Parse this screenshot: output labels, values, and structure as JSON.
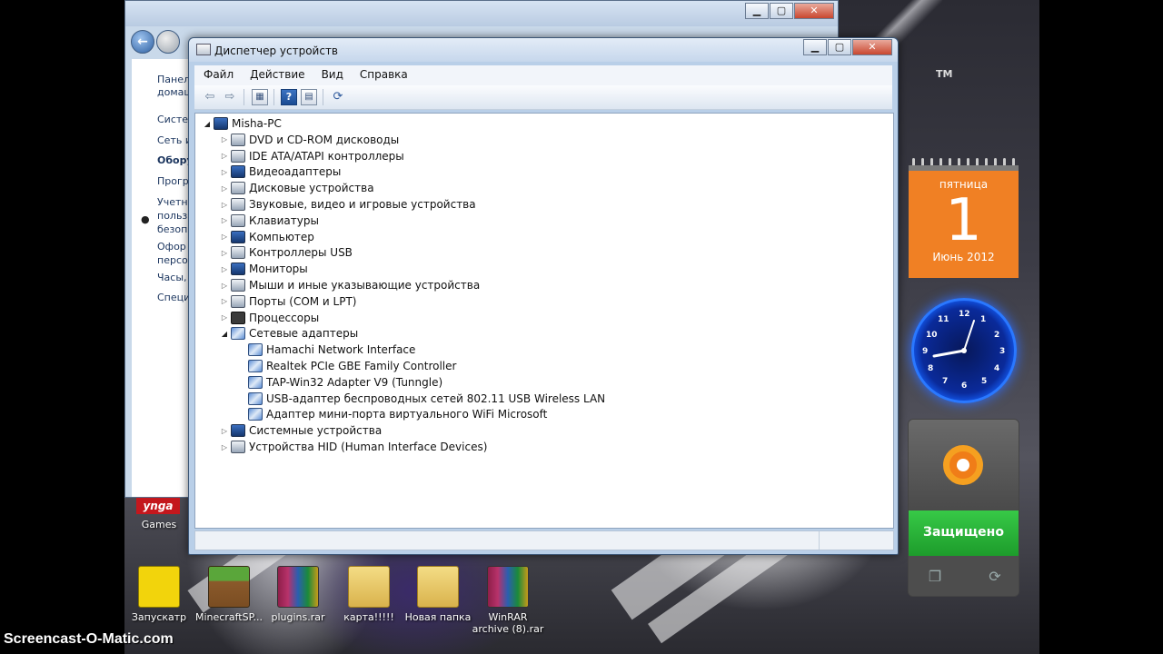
{
  "desktop": {
    "wallpaper_text": "",
    "tm": "TM",
    "watermark": "Screencast-O-Matic.com",
    "zynga_badge": "ynga",
    "zynga_label": "Games",
    "icons": [
      {
        "label": "Запускатр",
        "icon": "launcher-icon"
      },
      {
        "label": "MinecraftSP...",
        "icon": "minecraft-icon"
      },
      {
        "label": "plugins.rar",
        "icon": "winrar-icon"
      },
      {
        "label": "карта!!!!!",
        "icon": "folder-icon"
      },
      {
        "label": "Новая папка",
        "icon": "folder-icon"
      },
      {
        "label": "WinRAR archive (8).rar",
        "icon": "winrar-icon"
      }
    ]
  },
  "background_window": {
    "left_items": [
      "Панел",
      "домаш",
      "Систем",
      "Сеть и",
      "Обору",
      "Прогр",
      "Учетни",
      "польз",
      "безопа",
      "Офор",
      "персо",
      "Часы,",
      "Специ"
    ],
    "bullet": "●"
  },
  "device_manager": {
    "title": "Диспетчер устройств",
    "menu": [
      "Файл",
      "Действие",
      "Вид",
      "Справка"
    ],
    "toolbar": {
      "back": "⇦",
      "forward": "⇨",
      "help": "?",
      "props": "▤",
      "view": "▦",
      "scan": "⟳"
    },
    "caption": {
      "minimize": "▁",
      "maximize": "▢",
      "close": "✕"
    },
    "tree": [
      {
        "label": "Misha-PC",
        "level": 0,
        "expanded": true,
        "icon": "computer-icon"
      },
      {
        "label": "DVD и CD-ROM дисководы",
        "level": 1,
        "expanded": false,
        "icon": "dvd-drive-icon"
      },
      {
        "label": "IDE ATA/ATAPI контроллеры",
        "level": 1,
        "expanded": false,
        "icon": "ide-controller-icon"
      },
      {
        "label": "Видеоадаптеры",
        "level": 1,
        "expanded": false,
        "icon": "display-adapter-icon"
      },
      {
        "label": "Дисковые устройства",
        "level": 1,
        "expanded": false,
        "icon": "disk-drive-icon"
      },
      {
        "label": "Звуковые, видео и игровые устройства",
        "level": 1,
        "expanded": false,
        "icon": "speaker-icon"
      },
      {
        "label": "Клавиатуры",
        "level": 1,
        "expanded": false,
        "icon": "keyboard-icon"
      },
      {
        "label": "Компьютер",
        "level": 1,
        "expanded": false,
        "icon": "computer-icon"
      },
      {
        "label": "Контроллеры USB",
        "level": 1,
        "expanded": false,
        "icon": "usb-icon"
      },
      {
        "label": "Мониторы",
        "level": 1,
        "expanded": false,
        "icon": "monitor-icon"
      },
      {
        "label": "Мыши и иные указывающие устройства",
        "level": 1,
        "expanded": false,
        "icon": "mouse-icon"
      },
      {
        "label": "Порты (COM и LPT)",
        "level": 1,
        "expanded": false,
        "icon": "port-icon"
      },
      {
        "label": "Процессоры",
        "level": 1,
        "expanded": false,
        "icon": "processor-icon"
      },
      {
        "label": "Сетевые адаптеры",
        "level": 1,
        "expanded": true,
        "icon": "network-adapter-icon"
      },
      {
        "label": "Hamachi Network Interface",
        "level": 2,
        "expanded": null,
        "icon": "network-adapter-icon"
      },
      {
        "label": "Realtek PCIe GBE Family Controller",
        "level": 2,
        "expanded": null,
        "icon": "network-adapter-icon"
      },
      {
        "label": "TAP-Win32 Adapter V9 (Tunngle)",
        "level": 2,
        "expanded": null,
        "icon": "network-adapter-icon"
      },
      {
        "label": "USB-адаптер беспроводных сетей 802.11 USB Wireless LAN",
        "level": 2,
        "expanded": null,
        "icon": "network-adapter-icon"
      },
      {
        "label": "Адаптер мини-порта виртуального WiFi Microsoft",
        "level": 2,
        "expanded": null,
        "icon": "network-adapter-icon"
      },
      {
        "label": "Системные устройства",
        "level": 1,
        "expanded": false,
        "icon": "system-device-icon"
      },
      {
        "label": "Устройства HID (Human Interface Devices)",
        "level": 1,
        "expanded": false,
        "icon": "hid-icon"
      }
    ]
  },
  "calendar_gadget": {
    "weekday": "пятница",
    "day": "1",
    "month_year": "Июнь 2012"
  },
  "clock_gadget": {
    "numbers": [
      "12",
      "1",
      "2",
      "3",
      "4",
      "5",
      "6",
      "7",
      "8",
      "9",
      "10",
      "11"
    ]
  },
  "avast_gadget": {
    "status": "Защищено",
    "accent": "#f07d18",
    "ok_color": "#2bb33c"
  }
}
